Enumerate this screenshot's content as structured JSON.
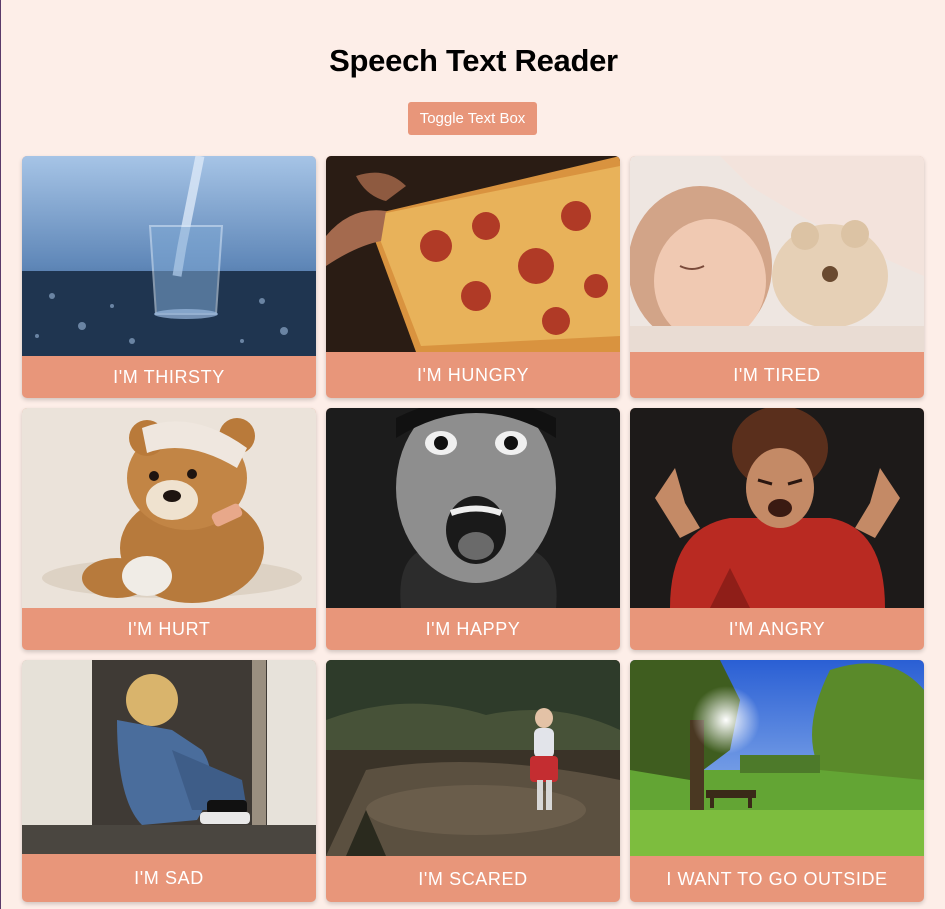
{
  "header": {
    "title": "Speech Text Reader"
  },
  "toolbar": {
    "toggle_label": "Toggle Text Box"
  },
  "cards": [
    {
      "label": "I'M THIRSTY",
      "image": "glass-of-water"
    },
    {
      "label": "I'M HUNGRY",
      "image": "pizza-slice"
    },
    {
      "label": "I'M TIRED",
      "image": "sleeping-child"
    },
    {
      "label": "I'M HURT",
      "image": "bandaged-teddy-bear"
    },
    {
      "label": "I'M HAPPY",
      "image": "excited-boy"
    },
    {
      "label": "I'M ANGRY",
      "image": "angry-child"
    },
    {
      "label": "I'M SAD",
      "image": "sad-child-in-doorway"
    },
    {
      "label": "I'M SCARED",
      "image": "child-in-forest"
    },
    {
      "label": "I WANT TO GO OUTSIDE",
      "image": "park-with-sun"
    }
  ],
  "colors": {
    "background": "#fdeee8",
    "accent": "#e8967a",
    "label_text": "#ffffff"
  }
}
